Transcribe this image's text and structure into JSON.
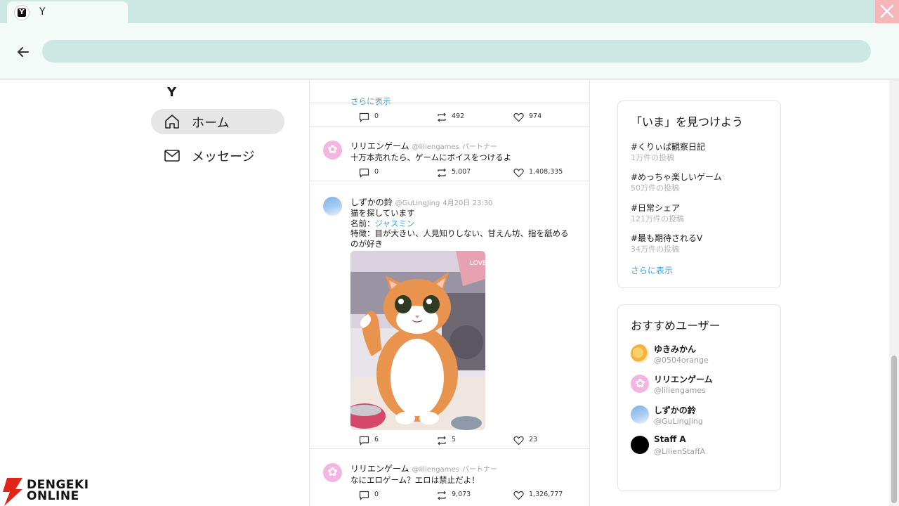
{
  "browser": {
    "tab_title": "Y",
    "tab_icon": "y-logo-icon",
    "url": ""
  },
  "nav": {
    "logo": "Y",
    "items": [
      {
        "label": "ホーム",
        "icon": "home-icon",
        "active": true
      },
      {
        "label": "メッセージ",
        "icon": "mail-icon",
        "active": false
      }
    ]
  },
  "feed": {
    "top_post": {
      "more_text": "さらに表示",
      "replies": "0",
      "retweets": "492",
      "likes": "974"
    },
    "posts": [
      {
        "name": "リリエンゲーム",
        "handle": "@liliengames",
        "badge": "パートナー",
        "text": "十万本売れたら、ゲームにボイスをつけるよ",
        "replies": "0",
        "retweets": "5,007",
        "likes": "1,408,335"
      },
      {
        "name": "しずかの鈴",
        "handle": "@GuLingJing",
        "time": "4月20日 23:30",
        "line1": "猫を探しています",
        "line2_label": "名前：",
        "line2_link": "ジャスミン",
        "line3": "特徴：目が大きい、人見知りしない、甘えん坊、指を舐める",
        "line4": "のが好き",
        "image_sign": "LOVE",
        "replies": "6",
        "retweets": "5",
        "likes": "23"
      },
      {
        "name": "リリエンゲーム",
        "handle": "@liliengames",
        "badge": "パートナー",
        "text": "なにエロゲーム？エロは禁止だよ！",
        "replies": "0",
        "retweets": "9,073",
        "likes": "1,326,777"
      }
    ]
  },
  "trends": {
    "title": "「いま」を見つけよう",
    "items": [
      {
        "tag": "#くりぃぱ観察日記",
        "count": "1万件の投稿"
      },
      {
        "tag": "#めっちゃ楽しいゲーム",
        "count": "50万件の投稿"
      },
      {
        "tag": "#日常シェア",
        "count": "121万件の投稿"
      },
      {
        "tag": "#最も期待されるV",
        "count": "34万件の投稿"
      }
    ],
    "more": "さらに表示"
  },
  "recommend": {
    "title": "おすすめユーザー",
    "users": [
      {
        "name": "ゆきみかん",
        "handle": "@0504orange"
      },
      {
        "name": "リリエンゲーム",
        "handle": "@liliengames"
      },
      {
        "name": "しずかの鈴",
        "handle": "@GuLingJing"
      },
      {
        "name": "Staff A",
        "handle": "@LilienStaffA"
      }
    ]
  },
  "watermark": {
    "line1": "DENGEKI",
    "line2": "ONLINE"
  },
  "colors": {
    "accent": "#3aa0d8",
    "chrome": "#cde8e2",
    "close": "#f6b6b9"
  }
}
